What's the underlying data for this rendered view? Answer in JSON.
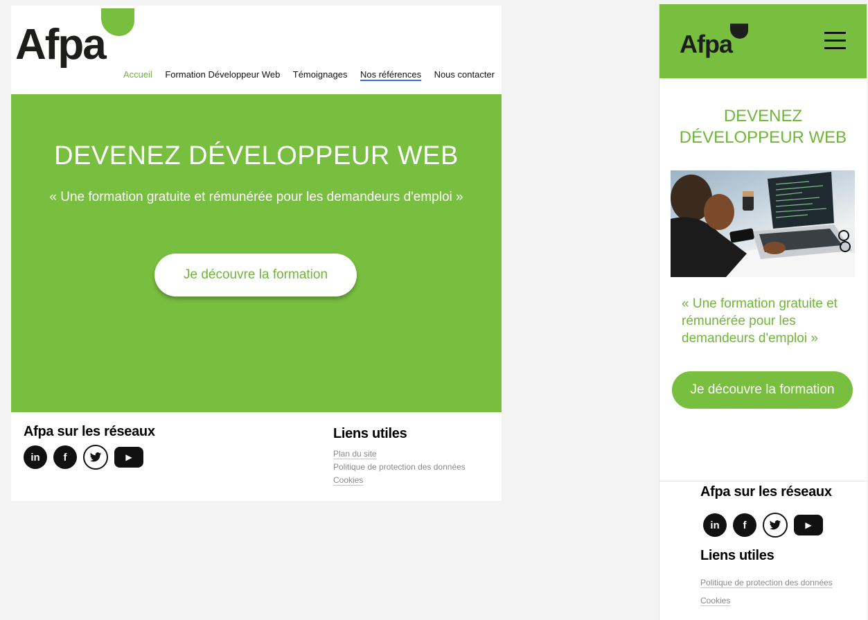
{
  "brand": {
    "logo_text": "Afpa",
    "accent_color": "#78be3f",
    "accent_text_color": "#6fb53a"
  },
  "nav": {
    "items": [
      {
        "label": "Accueil",
        "state": "active"
      },
      {
        "label": "Formation Développeur Web",
        "state": "normal"
      },
      {
        "label": "Témoignages",
        "state": "normal"
      },
      {
        "label": "Nos références",
        "state": "hover"
      },
      {
        "label": "Nous contacter",
        "state": "normal"
      }
    ]
  },
  "hero": {
    "title": "DEVENEZ DÉVELOPPEUR WEB",
    "tagline": "« Une formation gratuite et rémunérée pour les demandeurs d'emploi »",
    "cta_label": "Je découvre la formation"
  },
  "footer": {
    "social_heading": "Afpa sur les réseaux",
    "social_icons": [
      {
        "name": "linkedin-icon",
        "glyph": "in"
      },
      {
        "name": "facebook-icon",
        "glyph": "f"
      },
      {
        "name": "twitter-icon",
        "glyph": "🐦"
      },
      {
        "name": "youtube-icon",
        "glyph": "▶"
      }
    ],
    "links_heading": "Liens utiles",
    "links": [
      "Plan du site",
      "Politique de protection des données",
      "Cookies"
    ]
  },
  "mobile": {
    "title_line1": "DEVENEZ",
    "title_line2": "DÉVELOPPEUR WEB",
    "tagline": "« Une formation gratuite et rémunérée pour les demandeurs d'emploi »",
    "cta_label": "Je découvre la formation",
    "social_heading": "Afpa sur les réseaux",
    "links_heading": "Liens utiles",
    "links": [
      "Politique de protection des données",
      "Cookies"
    ]
  }
}
